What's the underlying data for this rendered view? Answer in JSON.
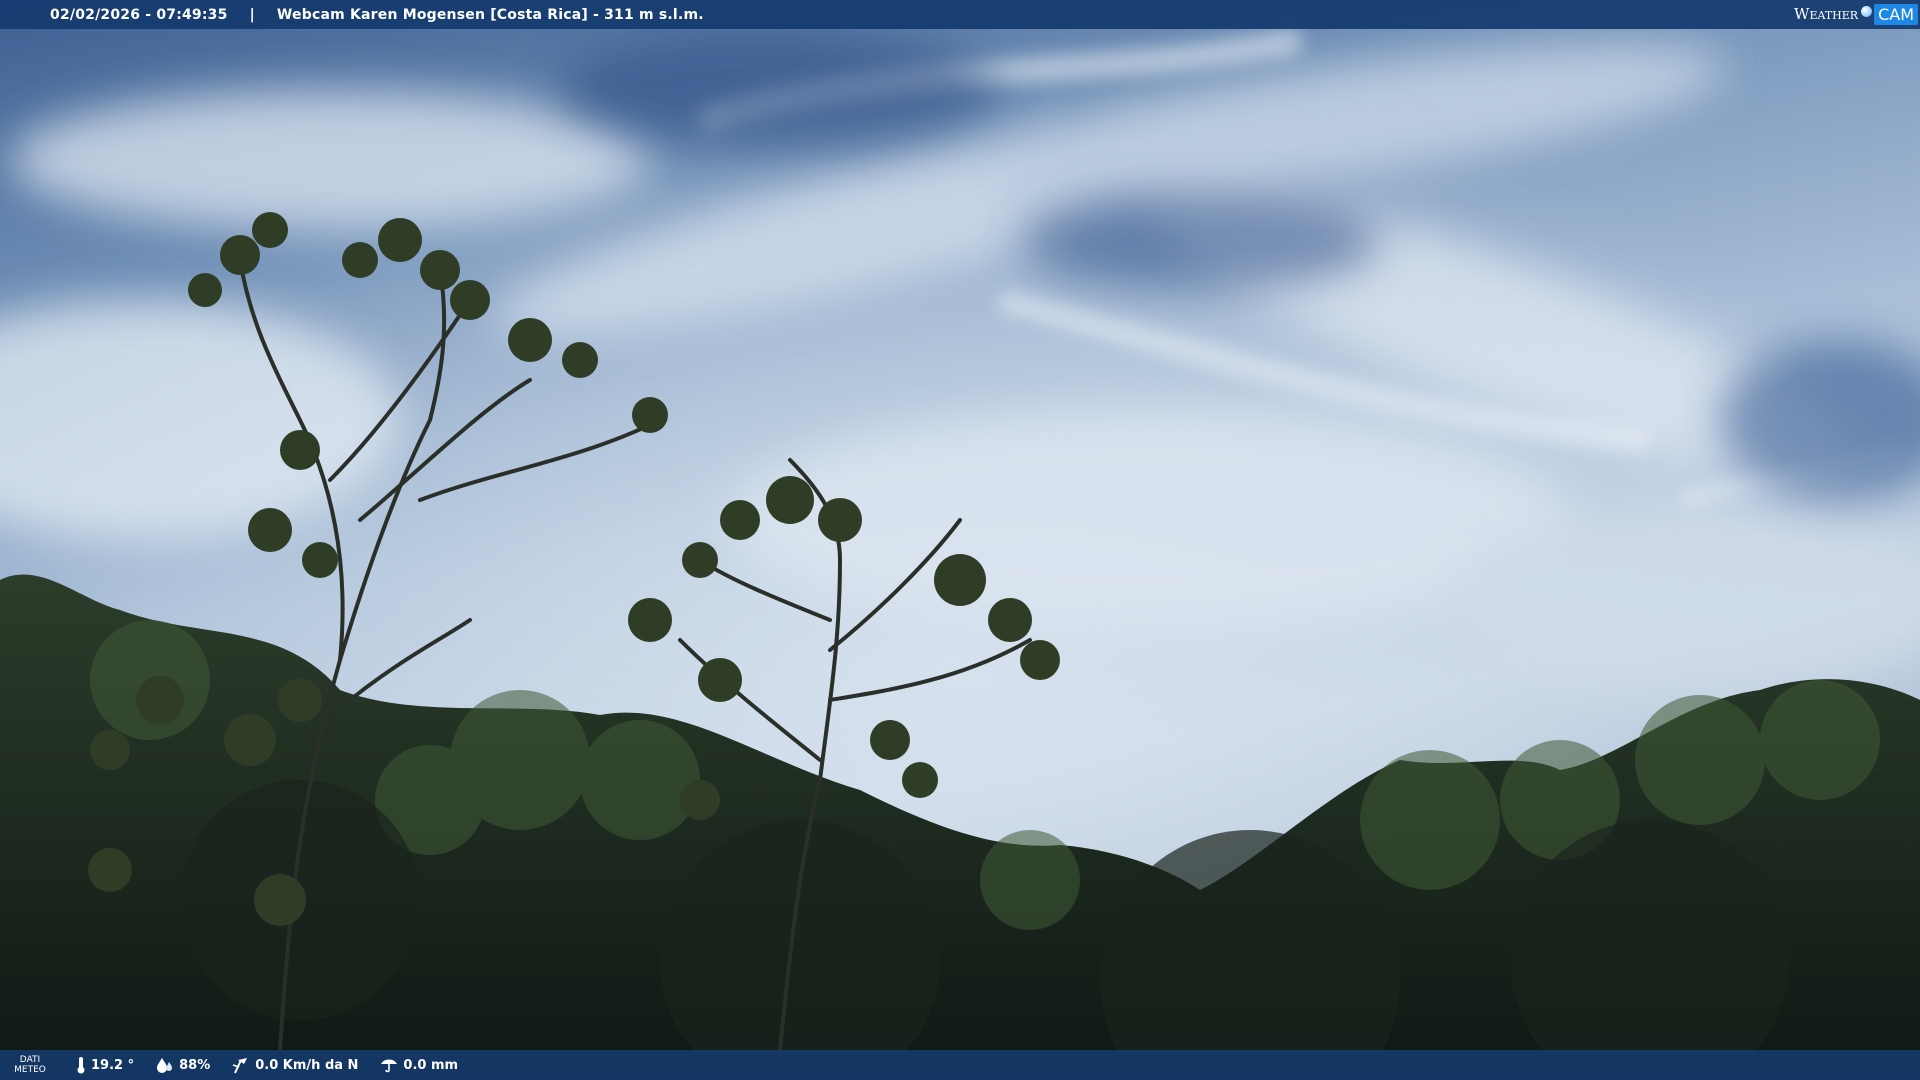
{
  "overlay_top": {
    "datetime": "02/02/2026 - 07:49:35",
    "separator": "|",
    "caption": "Webcam Karen Mogensen [Costa Rica]  - 311 m s.l.m."
  },
  "logo": {
    "weather": "Weather",
    "cam": "CAM"
  },
  "overlay_bottom": {
    "dati_line1": "DATI",
    "dati_line2": "METEO",
    "temperature": "19.2 °",
    "humidity": "88%",
    "wind": "0.0 Km/h da N",
    "rain": "0.0 mm"
  },
  "colors": {
    "bar": "#143a6e",
    "sky_top": "#3c5f93",
    "sky_mid": "#b9cbe0",
    "foliage": "#1d2a1f"
  },
  "icons": {
    "temperature": "thermometer-icon",
    "humidity": "humidity-drop-icon",
    "wind": "wind-vane-icon",
    "rain": "rain-gauge-icon"
  }
}
